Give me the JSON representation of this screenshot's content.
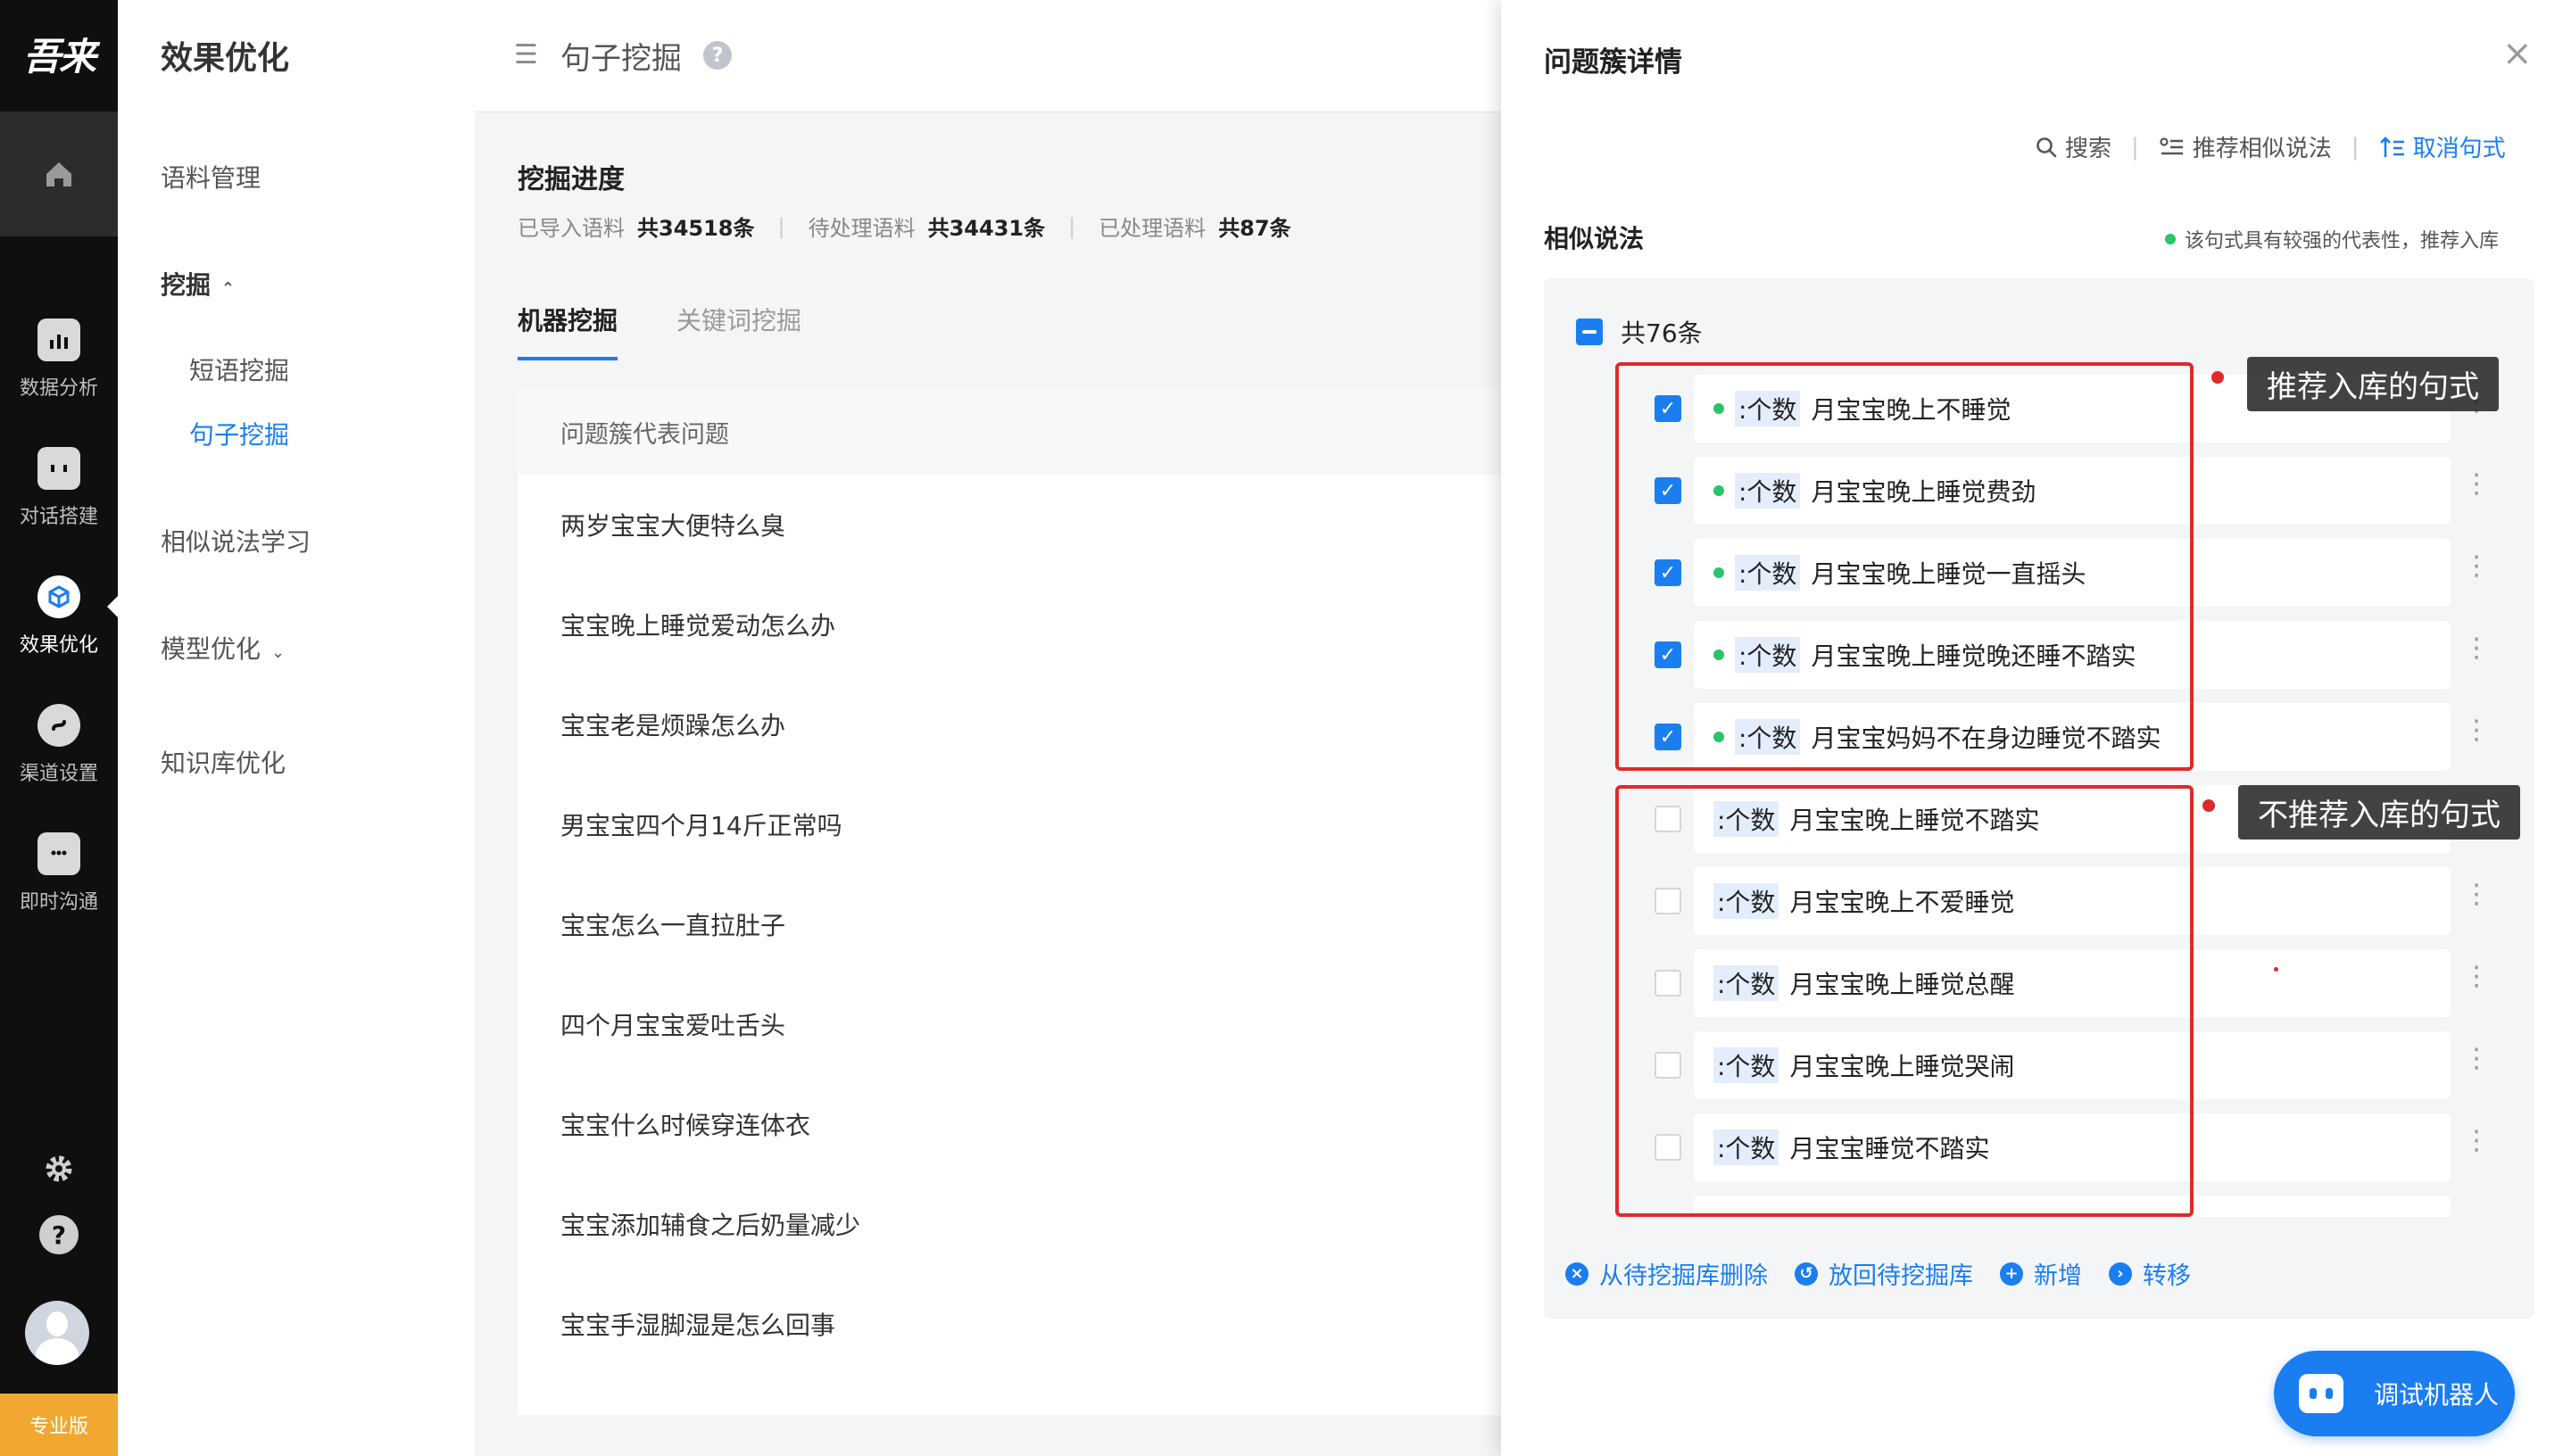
{
  "rail": {
    "logo": "吾来",
    "items": [
      {
        "label": "数据分析",
        "icon": "bar-chart-icon"
      },
      {
        "label": "对话搭建",
        "icon": "robot-icon"
      },
      {
        "label": "效果优化",
        "icon": "cube-icon",
        "active": true
      },
      {
        "label": "渠道设置",
        "icon": "channel-icon"
      },
      {
        "label": "即时沟通",
        "icon": "chat-icon"
      }
    ],
    "settings_icon": "gear-icon",
    "help_icon": "question-icon",
    "edition": "专业版"
  },
  "subnav": {
    "title": "效果优化",
    "corpus": "语料管理",
    "mining": "挖掘",
    "phrase_mining": "短语挖掘",
    "sentence_mining": "句子挖掘",
    "similar_learning": "相似说法学习",
    "model_opt": "模型优化",
    "kb_opt": "知识库优化"
  },
  "header": {
    "title": "句子挖掘",
    "help": "?"
  },
  "progress": {
    "title": "挖掘进度",
    "imported_label": "已导入语料",
    "imported_value": "共34518条",
    "pending_label": "待处理语料",
    "pending_value": "共34431条",
    "processed_label": "已处理语料",
    "processed_value": "共87条"
  },
  "tabs": [
    "机器挖掘",
    "关键词挖掘"
  ],
  "table": {
    "header": "问题簇代表问题",
    "rows": [
      "两岁宝宝大便特么臭",
      "宝宝晚上睡觉爱动怎么办",
      "宝宝老是烦躁怎么办",
      "男宝宝四个月14斤正常吗",
      "宝宝怎么一直拉肚子",
      "四个月宝宝爱吐舌头",
      "宝宝什么时候穿连体衣",
      "宝宝添加辅食之后奶量减少",
      "宝宝手湿脚湿是怎么回事"
    ]
  },
  "drawer": {
    "title": "问题簇详情",
    "close": "×",
    "tools": {
      "search": "搜索",
      "recommend": "推荐相似说法",
      "cancel": "取消句式"
    },
    "similar_title": "相似说法",
    "hint": "该句式具有较强的代表性，推荐入库",
    "total": "共76条",
    "tag": ":个数",
    "items": [
      {
        "text": "月宝宝晚上不睡觉",
        "checked": true,
        "recommended": true
      },
      {
        "text": "月宝宝晚上睡觉费劲",
        "checked": true,
        "recommended": true
      },
      {
        "text": "月宝宝晚上睡觉一直摇头",
        "checked": true,
        "recommended": true
      },
      {
        "text": "月宝宝晚上睡觉晚还睡不踏实",
        "checked": true,
        "recommended": true
      },
      {
        "text": "月宝宝妈妈不在身边睡觉不踏实",
        "checked": true,
        "recommended": true
      },
      {
        "text": "月宝宝晚上睡觉不踏实",
        "checked": false,
        "recommended": false
      },
      {
        "text": "月宝宝晚上不爱睡觉",
        "checked": false,
        "recommended": false
      },
      {
        "text": "月宝宝晚上睡觉总醒",
        "checked": false,
        "recommended": false
      },
      {
        "text": "月宝宝晚上睡觉哭闹",
        "checked": false,
        "recommended": false
      },
      {
        "text": "月宝宝睡觉不踏实",
        "checked": false,
        "recommended": false
      }
    ],
    "annot_recommended": "推荐入库的句式",
    "annot_not_recommended": "不推荐入库的句式",
    "actions": {
      "delete": "从待挖掘库删除",
      "return": "放回待挖掘库",
      "add": "新增",
      "transfer": "转移"
    }
  },
  "robot_button": "调试机器人",
  "colors": {
    "accent": "#1a7ef0",
    "annotation_red": "#e02a2a",
    "recommend_green": "#2bc46a",
    "rail_bg": "#0f0f0f",
    "edition_badge": "#f0a830"
  }
}
